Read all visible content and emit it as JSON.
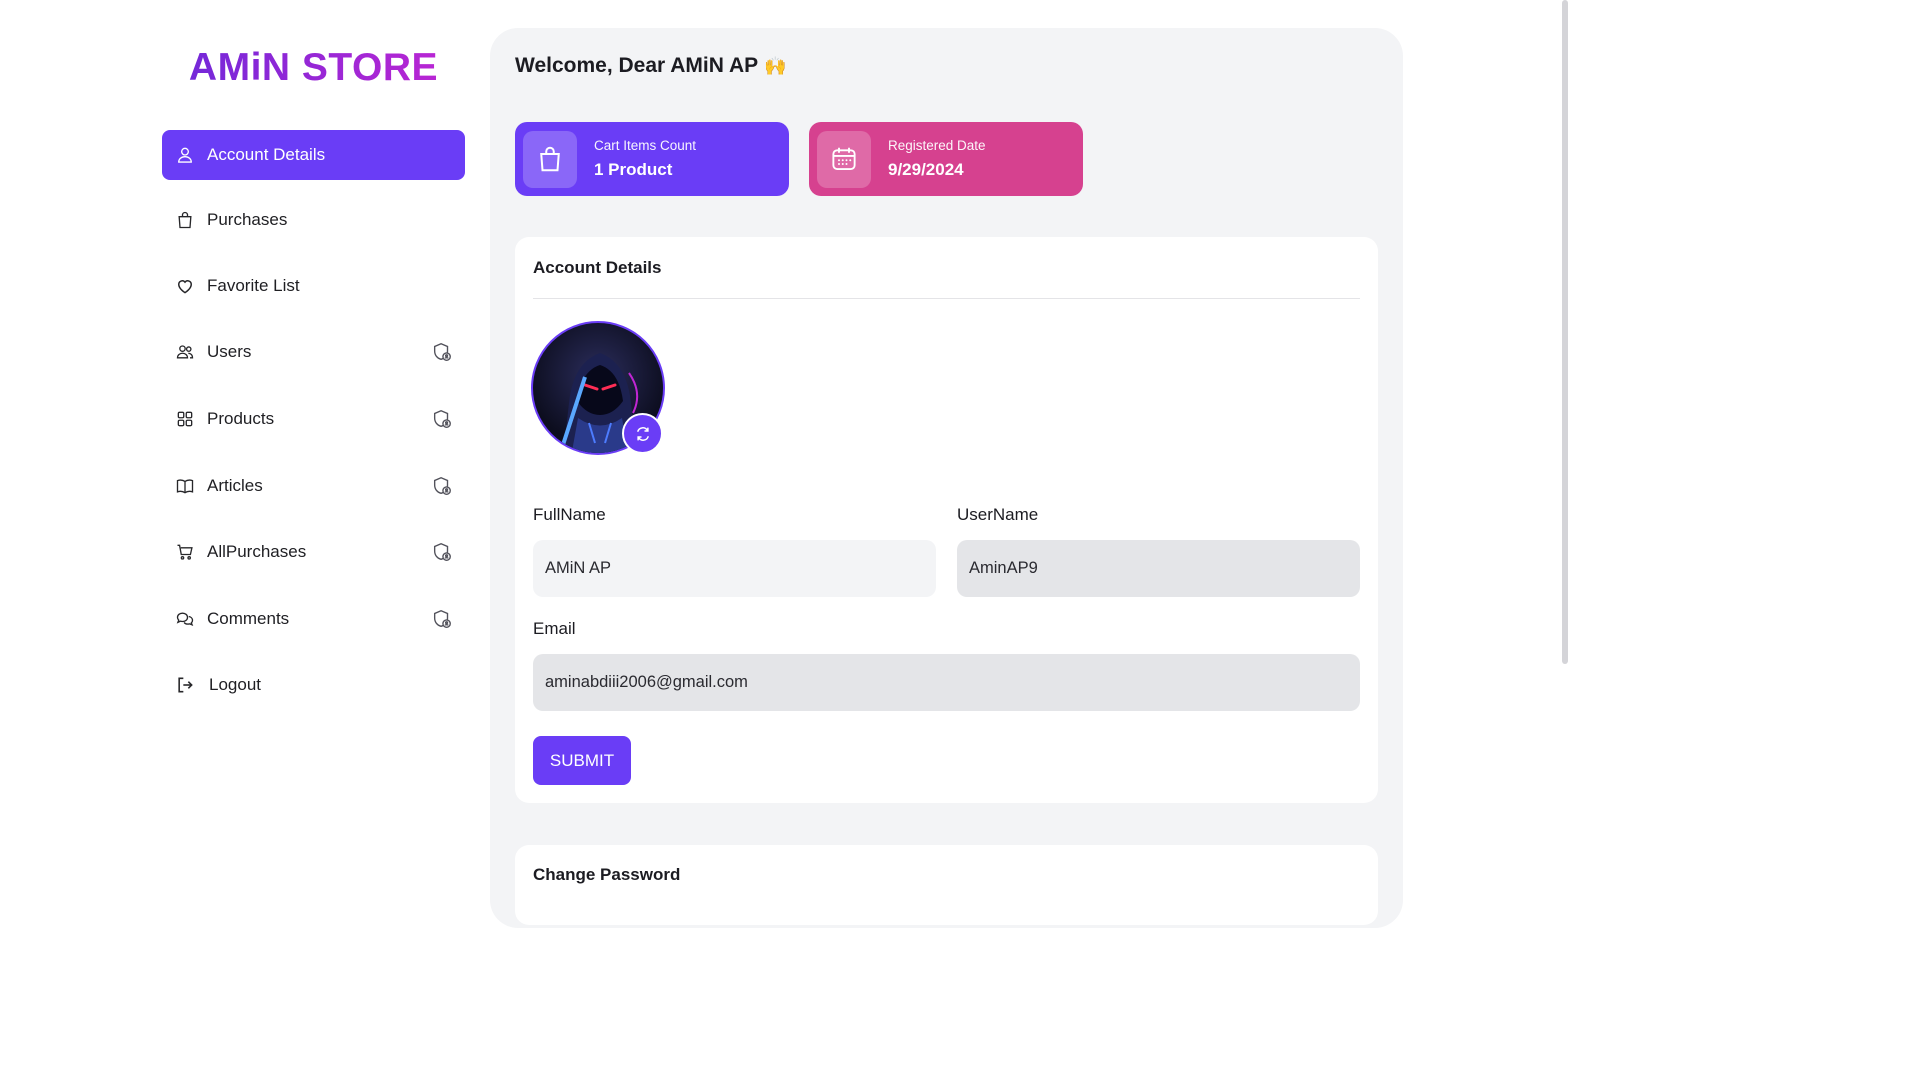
{
  "brand": "AMiN STORE",
  "nav": [
    {
      "label": "Account Details",
      "icon": "user-icon",
      "active": true,
      "admin": false
    },
    {
      "label": "Purchases",
      "icon": "shopping-bag-icon",
      "active": false,
      "admin": false
    },
    {
      "label": "Favorite List",
      "icon": "heart-icon",
      "active": false,
      "admin": false
    },
    {
      "label": "Users",
      "icon": "users-icon",
      "active": false,
      "admin": true
    },
    {
      "label": "Products",
      "icon": "grid-icon",
      "active": false,
      "admin": true
    },
    {
      "label": "Articles",
      "icon": "book-icon",
      "active": false,
      "admin": true
    },
    {
      "label": "AllPurchases",
      "icon": "cart-icon",
      "active": false,
      "admin": true
    },
    {
      "label": "Comments",
      "icon": "chat-bubbles-icon",
      "active": false,
      "admin": true
    },
    {
      "label": "Logout",
      "icon": "logout-icon",
      "active": false,
      "admin": false
    }
  ],
  "welcome": {
    "text": "Welcome, Dear AMiN AP",
    "emoji": "🙌"
  },
  "stats": {
    "cart": {
      "title": "Cart Items Count",
      "value": "1 Product",
      "icon": "shopping-bag-icon",
      "color": "#6a3df6"
    },
    "registered": {
      "title": "Registered Date",
      "value": "9/29/2024",
      "icon": "calendar-icon",
      "color": "#d6418f"
    }
  },
  "account": {
    "title": "Account Details",
    "avatar_alt": "hooded ninja avatar",
    "fullname_label": "FullName",
    "fullname_value": "AMiN AP",
    "username_label": "UserName",
    "username_value": "AminAP9",
    "email_label": "Email",
    "email_value": "aminabdiii2006@gmail.com",
    "submit_label": "SUBMIT"
  },
  "password_section": {
    "title": "Change Password"
  },
  "colors": {
    "accent": "#6a3df6",
    "pink": "#d6418f",
    "panel": "#f3f4f6"
  }
}
